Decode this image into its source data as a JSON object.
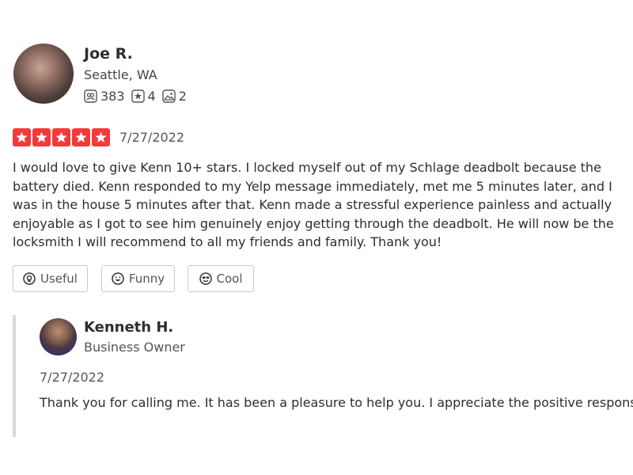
{
  "review": {
    "user": {
      "name": "Joe R.",
      "location": "Seattle, WA",
      "stats": {
        "friends": "383",
        "reviews": "4",
        "photos": "2"
      }
    },
    "rating": 5,
    "rating_max": 5,
    "date": "7/27/2022",
    "text": "I would love to give Kenn 10+ stars. I locked myself out of my Schlage deadbolt because the battery died. Kenn responded to my Yelp message immediately, met me 5 minutes later, and I was in the house 5 minutes after that. Kenn made a stressful experience painless and actually enjoyable as I got to see him genuinely enjoy getting through the deadbolt. He will now be the locksmith I will recommend to all my friends and family. Thank you!",
    "actions": {
      "useful": "Useful",
      "funny": "Funny",
      "cool": "Cool"
    }
  },
  "reply": {
    "owner_name": "Kenneth H.",
    "owner_role": "Business Owner",
    "date": "7/27/2022",
    "text": "Thank you for calling me. It has been a pleasure to help you. I appreciate the positive response."
  },
  "colors": {
    "star": "#f43939",
    "reply_border": "#d9d9d9"
  }
}
